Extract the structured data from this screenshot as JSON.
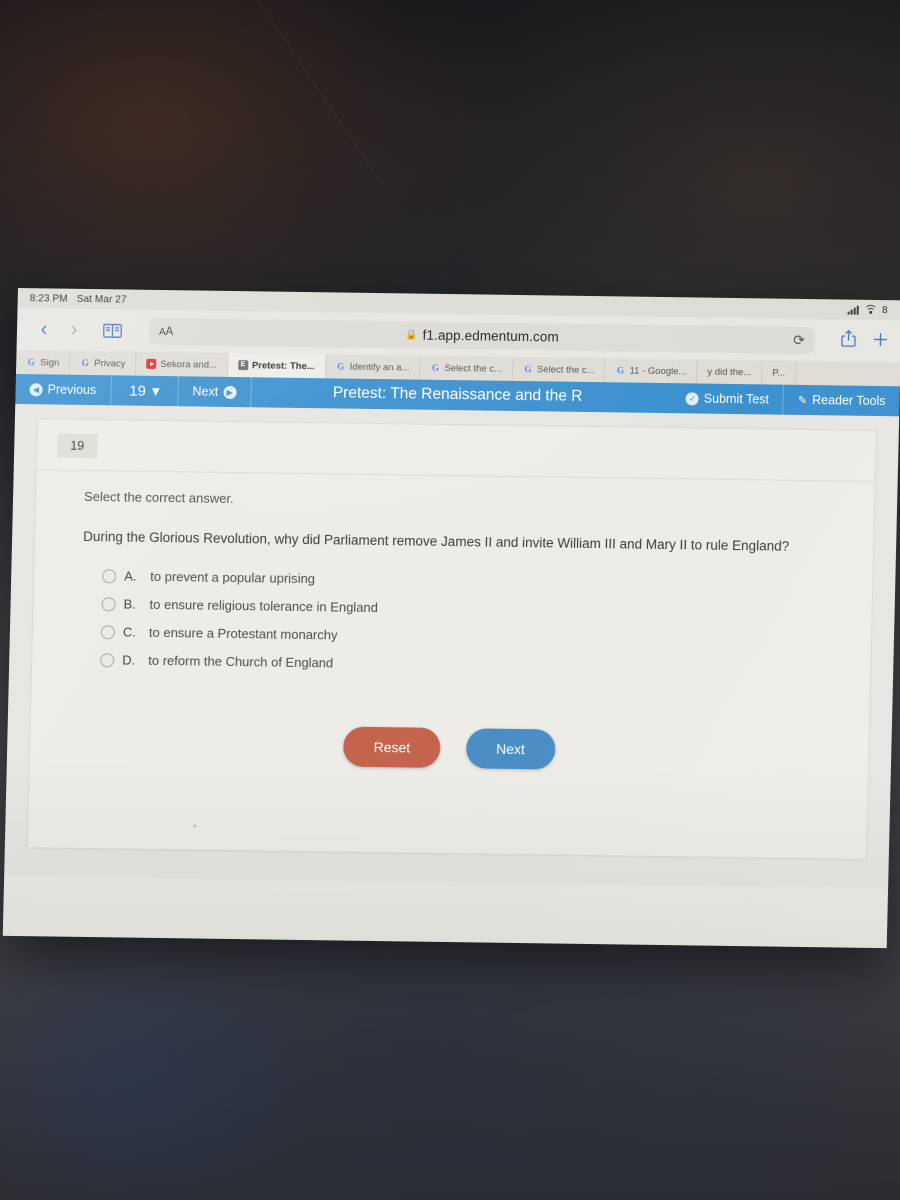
{
  "status_bar": {
    "time": "8:23 PM",
    "date": "Sat Mar 27",
    "battery": "8",
    "signal_icon": "cellular-signal-icon",
    "wifi_icon": "wifi-icon"
  },
  "safari": {
    "back_icon": "chevron-left-icon",
    "forward_icon": "chevron-right-icon",
    "bookmarks_icon": "book-icon",
    "aa_label": "A",
    "aa_label_small": "A",
    "lock_icon": "lock-icon",
    "url": "f1.app.edmentum.com",
    "reload_icon": "reload-icon",
    "share_icon": "share-icon",
    "new_tab_icon": "plus-icon",
    "tabs": [
      {
        "label": "Sign",
        "favicon": "google-icon",
        "active": false
      },
      {
        "label": "Privacy",
        "favicon": "google-icon",
        "active": false
      },
      {
        "label": "Sekora and...",
        "favicon": "youtube-icon",
        "active": false
      },
      {
        "label": "Pretest: The...",
        "favicon": "edmentum-icon",
        "active": true
      },
      {
        "label": "Identify an a...",
        "favicon": "google-icon",
        "active": false
      },
      {
        "label": "Select the c...",
        "favicon": "google-icon",
        "active": false
      },
      {
        "label": "Select the c...",
        "favicon": "google-icon",
        "active": false
      },
      {
        "label": "11 - Google...",
        "favicon": "google-icon",
        "active": false
      },
      {
        "label": "y did the...",
        "favicon": "none",
        "active": false
      },
      {
        "label": "P...",
        "favicon": "none",
        "active": false
      }
    ]
  },
  "app_bar": {
    "previous_label": "Previous",
    "previous_icon": "circle-left-arrow-icon",
    "question_number": "19",
    "question_dropdown_icon": "chevron-down-icon",
    "next_label": "Next",
    "next_icon": "circle-right-arrow-icon",
    "title": "Pretest: The Renaissance and the R",
    "submit_label": "Submit Test",
    "submit_icon": "circle-check-icon",
    "reader_tools_label": "Reader Tools",
    "reader_tools_icon": "pencil-icon",
    "background_color": "#3b90cf"
  },
  "question": {
    "number_badge": "19",
    "instruction": "Select the correct answer.",
    "text": "During the Glorious Revolution, why did Parliament remove James II and invite William III and Mary II to rule England?",
    "options": [
      {
        "letter": "A.",
        "text": "to prevent a popular uprising",
        "selected": false
      },
      {
        "letter": "B.",
        "text": "to ensure religious tolerance in England",
        "selected": false
      },
      {
        "letter": "C.",
        "text": "to ensure a Protestant monarchy",
        "selected": false
      },
      {
        "letter": "D.",
        "text": "to reform the Church of England",
        "selected": false
      }
    ]
  },
  "actions": {
    "reset_label": "Reset",
    "reset_color": "#c4644f",
    "next_label": "Next",
    "next_color": "#4b8ec6"
  }
}
